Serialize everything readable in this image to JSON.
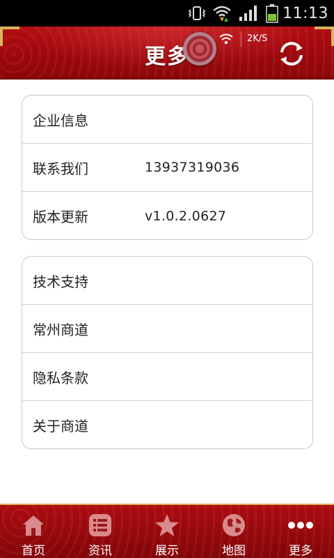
{
  "status_bar": {
    "time": "11:13",
    "icons": [
      "vibrate-icon",
      "wifi-icon",
      "signal-icon",
      "battery-icon"
    ]
  },
  "header": {
    "title": "更多",
    "speed": "2K/S",
    "refresh_icon": "refresh-icon"
  },
  "group1": [
    {
      "label": "企业信息",
      "value": ""
    },
    {
      "label": "联系我们",
      "value": "13937319036"
    },
    {
      "label": "版本更新",
      "value": "v1.0.2.0627"
    }
  ],
  "group2": [
    {
      "label": "技术支持"
    },
    {
      "label": "常州商道"
    },
    {
      "label": "隐私条款"
    },
    {
      "label": "关于商道"
    }
  ],
  "tabs": [
    {
      "label": "首页",
      "icon": "home-icon"
    },
    {
      "label": "资讯",
      "icon": "news-list-icon"
    },
    {
      "label": "展示",
      "icon": "star-icon"
    },
    {
      "label": "地图",
      "icon": "globe-icon"
    },
    {
      "label": "更多",
      "icon": "more-dots-icon"
    }
  ],
  "colors": {
    "header_red": "#a00a0e",
    "gold_trim": "#d8b55a",
    "tab_icon_inactive": "#d98a8c",
    "tab_icon_active": "#ffffff"
  }
}
